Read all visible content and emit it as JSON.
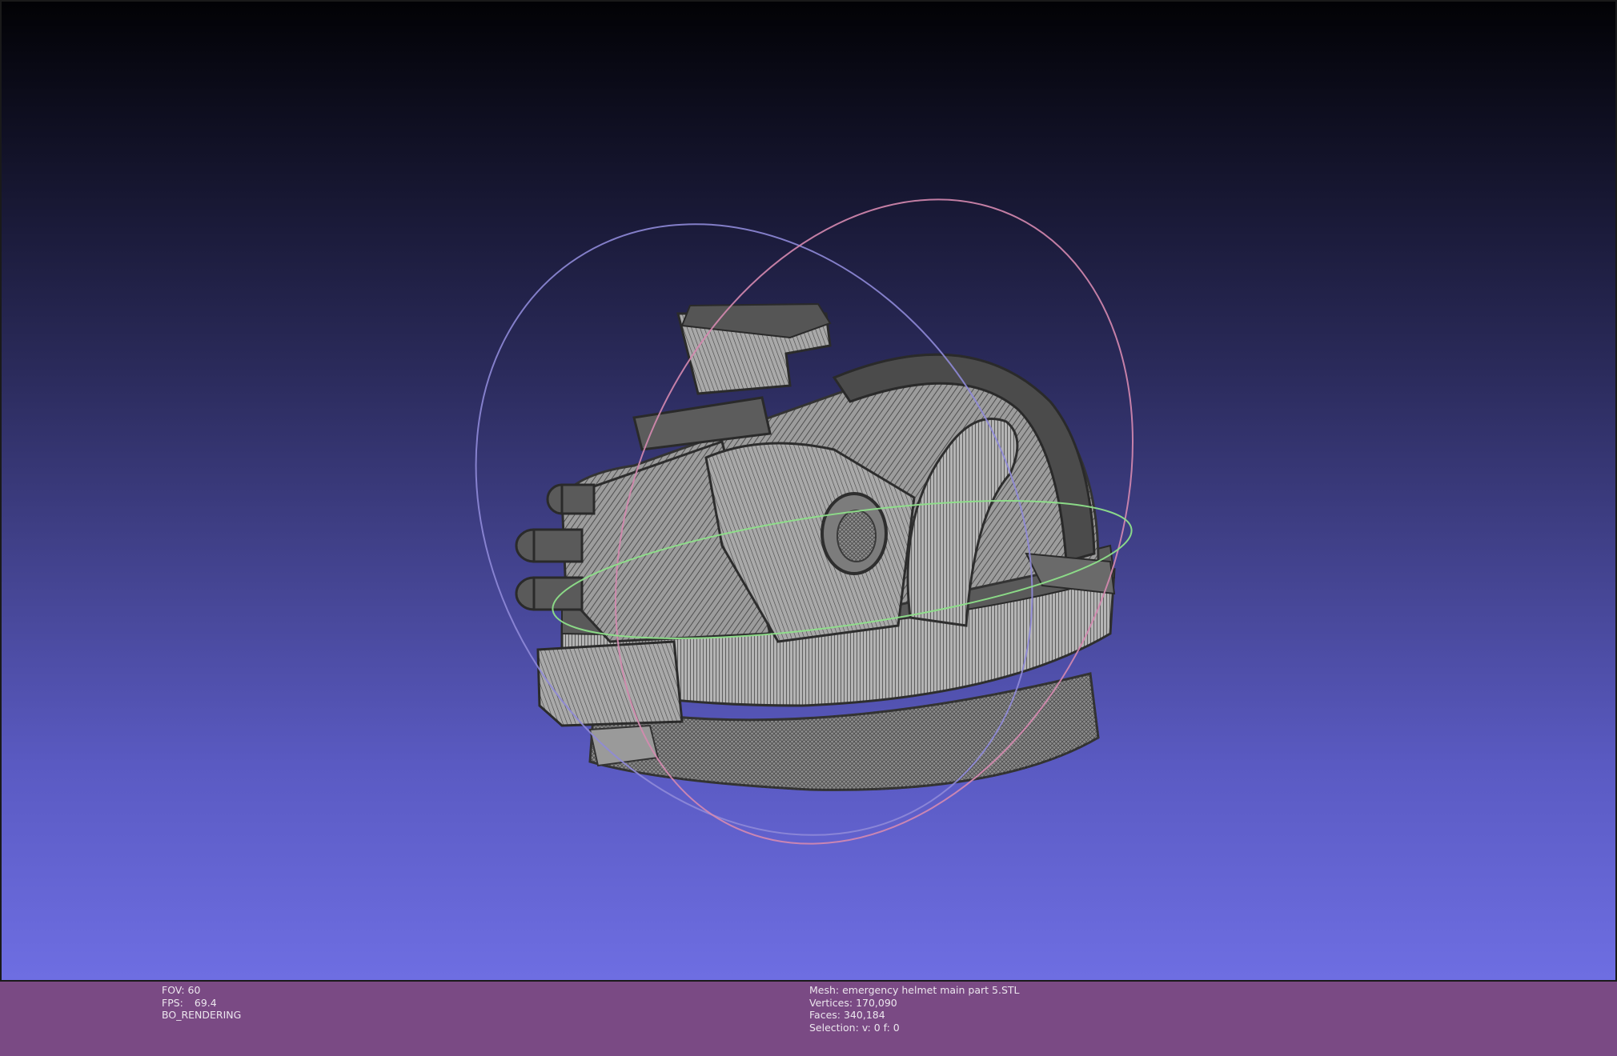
{
  "status_left": {
    "fov_label": "FOV:",
    "fov_value": "60",
    "fps_label": "FPS:",
    "fps_value": "69.4",
    "render_mode": "BO_RENDERING"
  },
  "status_right": {
    "mesh_label": "Mesh:",
    "mesh_name": "emergency helmet main part 5.STL",
    "vertices_label": "Vertices:",
    "vertices_value": "170,090",
    "faces_label": "Faces:",
    "faces_value": "340,184",
    "selection_label": "Selection:",
    "selection_value": "v: 0 f: 0"
  },
  "colors": {
    "background_top": "#020205",
    "background_bottom": "#6e6ee2",
    "status_bar": "#7a4a84",
    "mesh_surface": "#a8a8a8",
    "wireframe": "#3a3a3a",
    "trackball_x": "#d68ab0",
    "trackball_y": "#8f8ad8",
    "trackball_z": "#8ee08a"
  },
  "icons": {
    "model": "helmet-mesh",
    "trackball": "trackball-gizmo"
  }
}
